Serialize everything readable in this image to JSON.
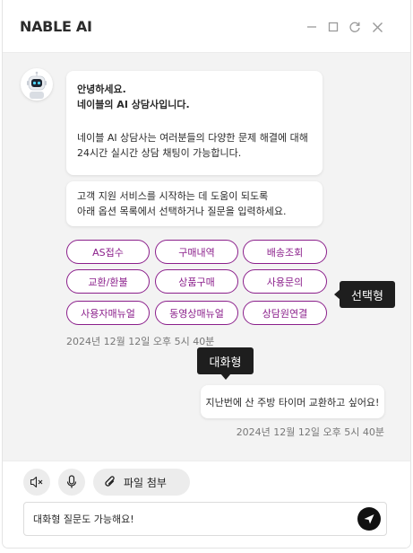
{
  "app": {
    "title": "NABLE AI"
  },
  "window_controls": [
    "minimize-icon",
    "maximize-icon",
    "refresh-icon",
    "close-icon"
  ],
  "bot_message": {
    "greeting": "안녕하세요.",
    "intro": "네이블의 AI 상담사입니다.",
    "body_line1": "네이블 AI 상담사는 여러분들의 다양한 문제 해결에 대해",
    "body_line2": "24시간 실시간 상담 채팅이 가능합니다."
  },
  "bot_message2": {
    "line1": "고객 지원 서비스를 시작하는 데 도움이 되도록",
    "line2": "아래 옵션 목록에서 선택하거나 질문을 입력하세요."
  },
  "options": [
    "AS접수",
    "구매내역",
    "배송조회",
    "교환/환불",
    "상품구매",
    "사용문의",
    "사용자매뉴얼",
    "동영상매뉴얼",
    "상담원연결"
  ],
  "bot_timestamp": "2024년 12월 12일 오후 5시 40분",
  "tooltips": {
    "options": "선택형",
    "chat": "대화형"
  },
  "user_message": {
    "text": "지난번에 산 주방 타이머 교환하고 싶어요!",
    "timestamp": "2024년 12월 12일 오후 5시 40분"
  },
  "toolbar": {
    "attach_label": "파일 첨부"
  },
  "input": {
    "value": "대화형 질문도 가능해요!"
  },
  "colors": {
    "accent": "#8b1f8b",
    "tooltip_bg": "#1e1e1e",
    "chat_bg": "#f3f3f3"
  }
}
